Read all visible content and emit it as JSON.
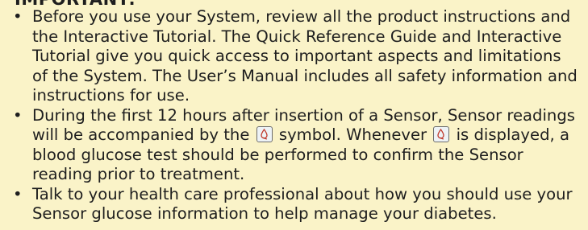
{
  "heading": "IMPORTANT:",
  "items": [
    {
      "lines": [
        "Before you use your System, review all the product instructions and",
        "the Interactive Tutorial. The Quick Reference Guide and Interactive",
        "Tutorial give you quick access to important aspects and limitations",
        "of the System. The User’s Manual includes all safety information and",
        "instructions for use."
      ]
    },
    {
      "line1": "During the first 12 hours after insertion of a Sensor, Sensor readings",
      "line2_a": "will be accompanied by the",
      "line2_b": "symbol. Whenever",
      "line2_c": "is displayed, a",
      "line3": "blood glucose test should be performed to confirm the Sensor",
      "line4": "reading prior to treatment.",
      "symbol_icon": "check-blood-glucose-icon"
    },
    {
      "lines": [
        "Talk to your health care professional about how you should use your",
        "Sensor glucose information to help manage your diabetes."
      ]
    }
  ],
  "bullet": "•",
  "colors": {
    "background": "#faf3c8",
    "text": "#1e1e1e",
    "symbol_red": "#c0392b"
  }
}
